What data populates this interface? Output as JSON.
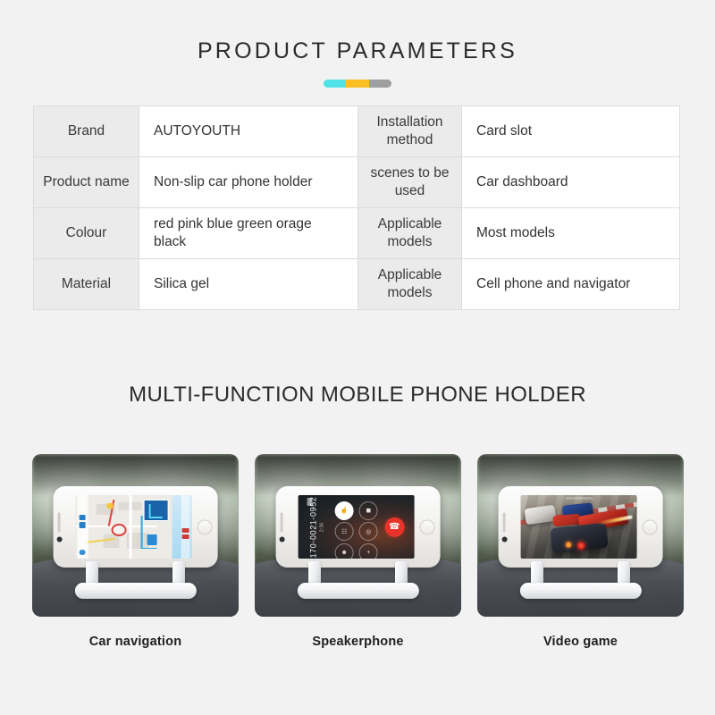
{
  "header": {
    "title": "PRODUCT PARAMETERS",
    "accent_colors": [
      "#4fe3e8",
      "#fbbf24",
      "#9e9e9e"
    ]
  },
  "parameters_table": {
    "rows": [
      {
        "label_left": "Brand",
        "value_left": "AUTOYOUTH",
        "label_right": "Installation method",
        "value_right": "Card slot"
      },
      {
        "label_left": "Product name",
        "value_left": "Non-slip car phone holder",
        "label_right": "scenes to be used",
        "value_right": "Car dashboard"
      },
      {
        "label_left": "Colour",
        "value_left": "red pink blue green orage black",
        "label_right": "Applicable models",
        "value_right": "Most models"
      },
      {
        "label_left": "Material",
        "value_left": "Silica gel",
        "label_right": "Applicable models",
        "value_right": "Cell phone and navigator"
      }
    ]
  },
  "gallery": {
    "heading": "MULTI-FUNCTION MOBILE PHONE HOLDER",
    "items": [
      {
        "caption": "Car navigation",
        "scene": "phone-on-holder-showing-map-navigation"
      },
      {
        "caption": "Speakerphone",
        "scene": "phone-on-holder-showing-active-call",
        "call_number": "170-0021-0952",
        "call_duration": "2:36",
        "call_buttons": [
          "speaker",
          "mute",
          "keypad",
          "add",
          "contacts",
          "plus"
        ],
        "end_call_icon": "phone-hangup-icon"
      },
      {
        "caption": "Video game",
        "scene": "phone-on-holder-showing-racing-game"
      }
    ]
  }
}
